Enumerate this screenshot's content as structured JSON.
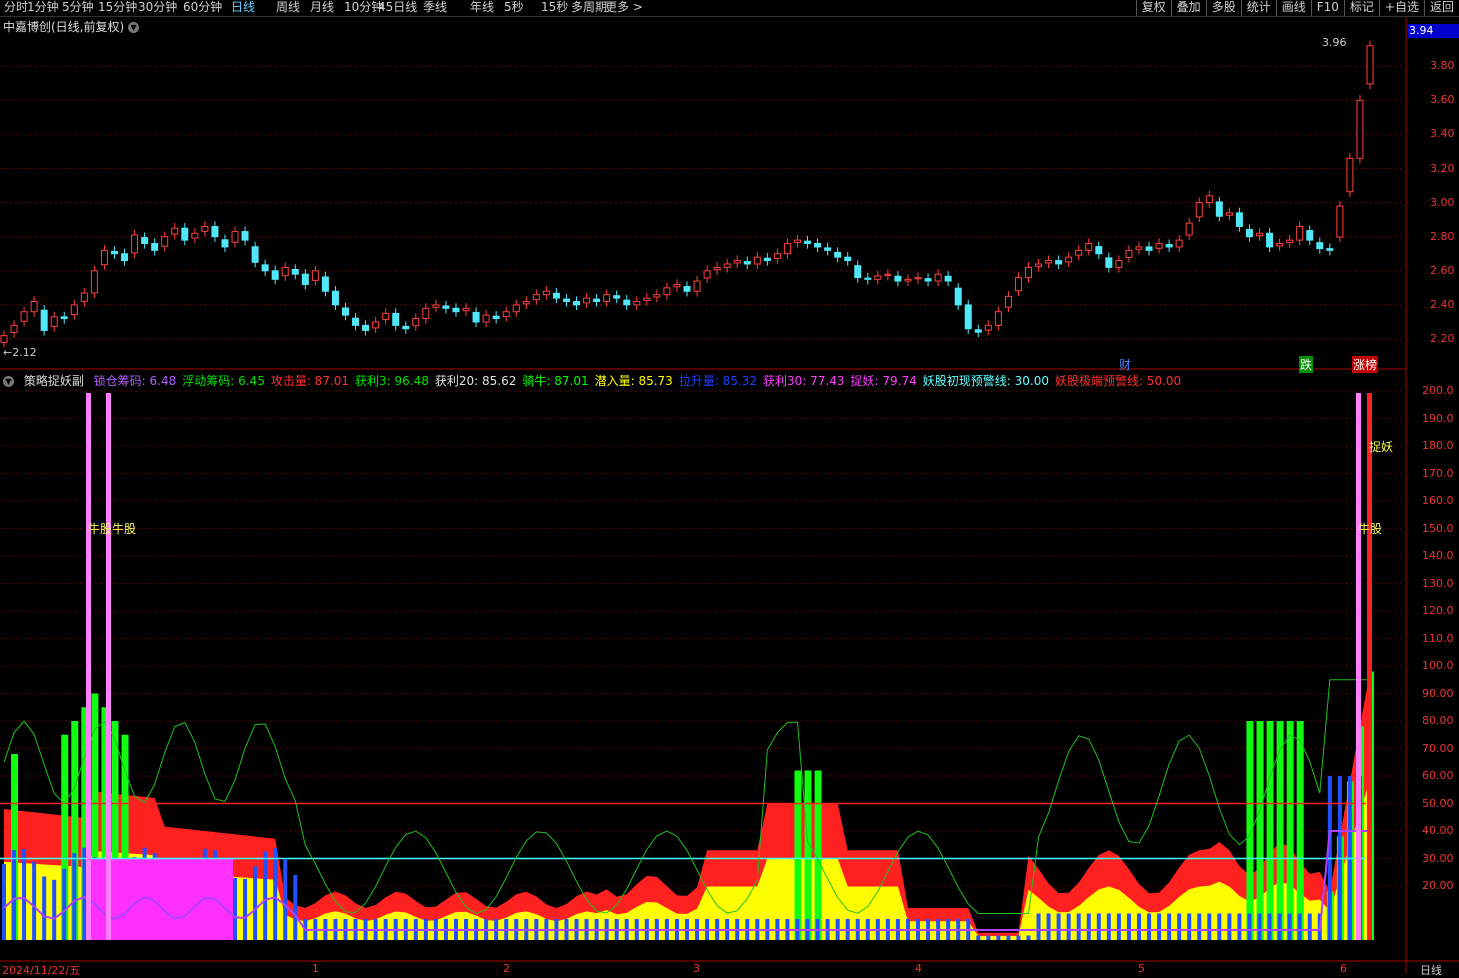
{
  "toolbar": {
    "periods": [
      "分时",
      "1分钟",
      "5分钟",
      "15分钟",
      "30分钟",
      "60分钟",
      "日线",
      "周线",
      "月线",
      "10分钟",
      "45日线",
      "季线",
      "年线",
      "5秒",
      "15秒",
      "多周期",
      "更多 >"
    ],
    "active_period": "日线",
    "actions": [
      "复权",
      "叠加",
      "多股",
      "统计",
      "画线",
      "F10",
      "标记",
      "+自选",
      "返回"
    ]
  },
  "main_chart": {
    "title": "中嘉博创(日线,前复权)",
    "high_label": "3.96",
    "low_label": "2.12",
    "current_price": "3.94",
    "y_ticks": [
      "3.80",
      "3.60",
      "3.40",
      "3.20",
      "3.00",
      "2.80",
      "2.60",
      "2.40",
      "2.20"
    ],
    "markers": {
      "cai": "财",
      "die": "跌",
      "zhangting": "涨榜"
    }
  },
  "indicator": {
    "title": "策略捉妖副",
    "items": [
      {
        "label": "锁仓筹码: 6.48",
        "color": "#b060ff"
      },
      {
        "label": "浮动筹码: 6.45",
        "color": "#00e000"
      },
      {
        "label": "攻击量: 87.01",
        "color": "#ff3030"
      },
      {
        "label": "获利3: 96.48",
        "color": "#00e000"
      },
      {
        "label": "获利20: 85.62",
        "color": "#e0e0e0"
      },
      {
        "label": "骑牛: 87.01",
        "color": "#00ff00"
      },
      {
        "label": "潜入量: 85.73",
        "color": "#ffff00"
      },
      {
        "label": "拉升量: 85.32",
        "color": "#2040ff"
      },
      {
        "label": "获利30: 77.43",
        "color": "#ff40ff"
      },
      {
        "label": "捉妖: 79.74",
        "color": "#ff40ff"
      },
      {
        "label": "妖股初现预警线: 30.00",
        "color": "#60ffff"
      },
      {
        "label": "妖股极端预警线: 50.00",
        "color": "#ff3030"
      }
    ],
    "y_ticks": [
      "200.0",
      "190.0",
      "180.0",
      "170.0",
      "160.0",
      "150.0",
      "140.0",
      "130.0",
      "120.0",
      "110.0",
      "100.0",
      "90.00",
      "80.00",
      "70.00",
      "60.00",
      "50.00",
      "40.00",
      "30.00",
      "20.00"
    ],
    "texts": {
      "niu1": "牛股牛股",
      "niu2": "牛股",
      "zhuoyao": "捉妖"
    }
  },
  "x_axis": {
    "start": "2024/11/22/五",
    "months": [
      "1",
      "2",
      "3",
      "4",
      "5",
      "6"
    ],
    "period_label": "日线"
  }
}
